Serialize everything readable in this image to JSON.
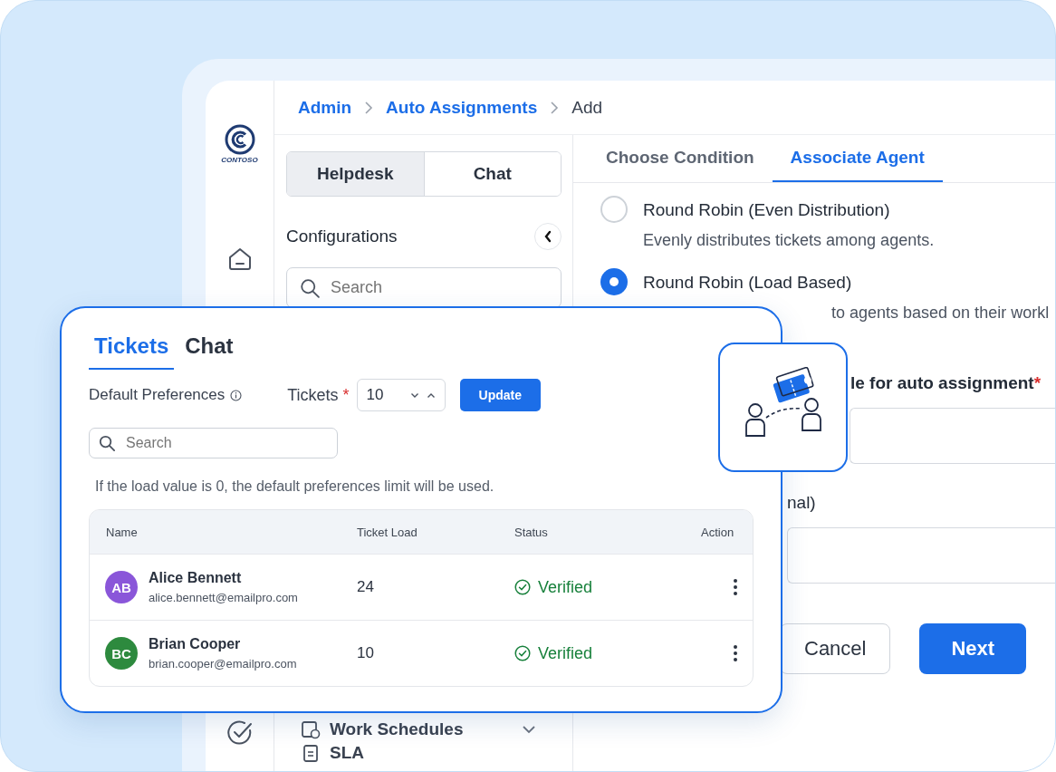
{
  "sidebar": {
    "logo": "CONTOSO"
  },
  "breadcrumb": [
    {
      "label": "Admin",
      "link": true
    },
    {
      "label": "Auto Assignments",
      "link": true
    },
    {
      "label": "Add",
      "link": false
    }
  ],
  "config_panel": {
    "segments": [
      {
        "label": "Helpdesk",
        "selected": true
      },
      {
        "label": "Chat",
        "selected": false
      }
    ],
    "title": "Configurations",
    "search": {
      "placeholder": "Search"
    },
    "items": [
      {
        "label": "Work Schedules",
        "expandable": true
      },
      {
        "label": "SLA",
        "expandable": false
      }
    ]
  },
  "steps": [
    {
      "label": "Choose Condition",
      "selected": false
    },
    {
      "label": "Associate Agent",
      "selected": true
    }
  ],
  "options": [
    {
      "title": "Round Robin (Even Distribution)",
      "description": "Evenly distributes tickets among agents.",
      "selected": false
    },
    {
      "title": "Round Robin (Load Based)",
      "description": "to agents based on their workl",
      "selected": true
    }
  ],
  "fields": [
    {
      "label": "le for auto assignment",
      "required_mark": "*"
    },
    {
      "label": "nal)"
    }
  ],
  "buttons": [
    {
      "label": "Cancel",
      "kind": "secondary"
    },
    {
      "label": "Next",
      "kind": "primary"
    }
  ],
  "popup": {
    "tabs": [
      {
        "label": "Tickets",
        "selected": true
      },
      {
        "label": "Chat",
        "selected": false
      }
    ],
    "default_preferences": "Default Preferences",
    "tickets_label": "Tickets",
    "tickets_required_mark": "*",
    "tickets_value": "10",
    "update_button": "Update",
    "search": {
      "placeholder": "Search"
    },
    "note": "If the load value is 0, the default preferences limit will be used.",
    "table": {
      "columns": [
        "Name",
        "Ticket Load",
        "Status",
        "Action"
      ],
      "rows": [
        {
          "initials": "AB",
          "color": "#8a56d9",
          "name": "Alice Bennett",
          "email": "alice.bennett@emailpro.com",
          "ticket_load": "24",
          "status": "Verified"
        },
        {
          "initials": "BC",
          "color": "#2d8a3e",
          "name": "Brian Cooper",
          "email": "brian.cooper@emailpro.com",
          "ticket_load": "10",
          "status": "Verified"
        }
      ]
    }
  }
}
